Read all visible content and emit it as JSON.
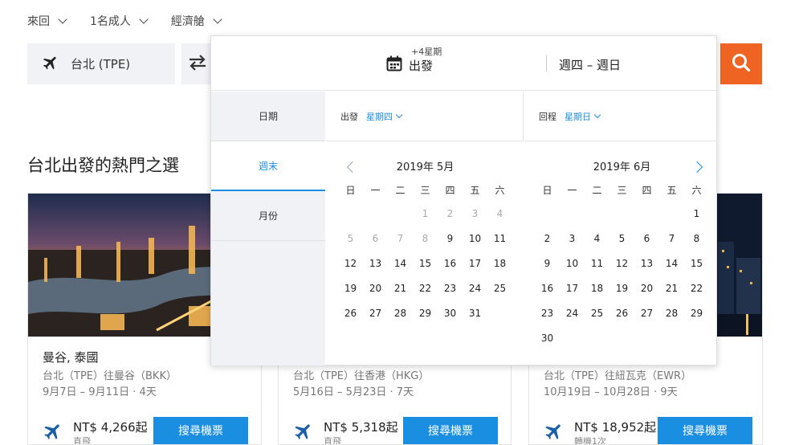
{
  "topbar": {
    "trip": "來回",
    "travelers": "1名成人",
    "cabin": "經濟艙"
  },
  "search": {
    "origin": "台北 (TPE)"
  },
  "section_title": "台北出發的熱門之選",
  "picker": {
    "plus_label": "+4星期",
    "depart_label": "出發",
    "range_label": "週四 – 週日",
    "tabs": [
      "日期",
      "週末",
      "月份"
    ],
    "depart_row": {
      "label": "出發",
      "value": "星期四"
    },
    "return_row": {
      "label": "回程",
      "value": "星期日"
    },
    "weekdays": [
      "日",
      "一",
      "二",
      "三",
      "四",
      "五",
      "六"
    ],
    "months": [
      {
        "title": "2019年 5月",
        "lead_blanks": 3,
        "days": 31,
        "past_until": 8
      },
      {
        "title": "2019年 6月",
        "lead_blanks": 6,
        "days": 30,
        "past_until": 0
      }
    ]
  },
  "cards": [
    {
      "city": "曼谷, 泰國",
      "route": "台北（TPE）往曼谷（BKK）",
      "dates": "9月7日 – 9月11日 · 4天",
      "price": "NT$ 4,266起",
      "stop": "直飛",
      "button": "搜尋機票"
    },
    {
      "city": "",
      "route": "台北（TPE）往香港（HKG）",
      "dates": "5月16日 – 5月23日 · 7天",
      "price": "NT$ 5,318起",
      "stop": "直飛",
      "button": "搜尋機票"
    },
    {
      "city": "",
      "route": "台北（TPE）往紐瓦克（EWR）",
      "dates": "10月19日 – 10月28日 · 9天",
      "price": "NT$ 18,952起",
      "stop": "轉機1次",
      "button": "搜尋機票"
    }
  ],
  "colors": {
    "accent": "#1a8ee1",
    "search_button": "#f06423"
  },
  "icons": {
    "origin": "plane-icon",
    "swap": "swap-arrows-icon",
    "search": "search-icon",
    "calendar": "calendar-icon"
  }
}
